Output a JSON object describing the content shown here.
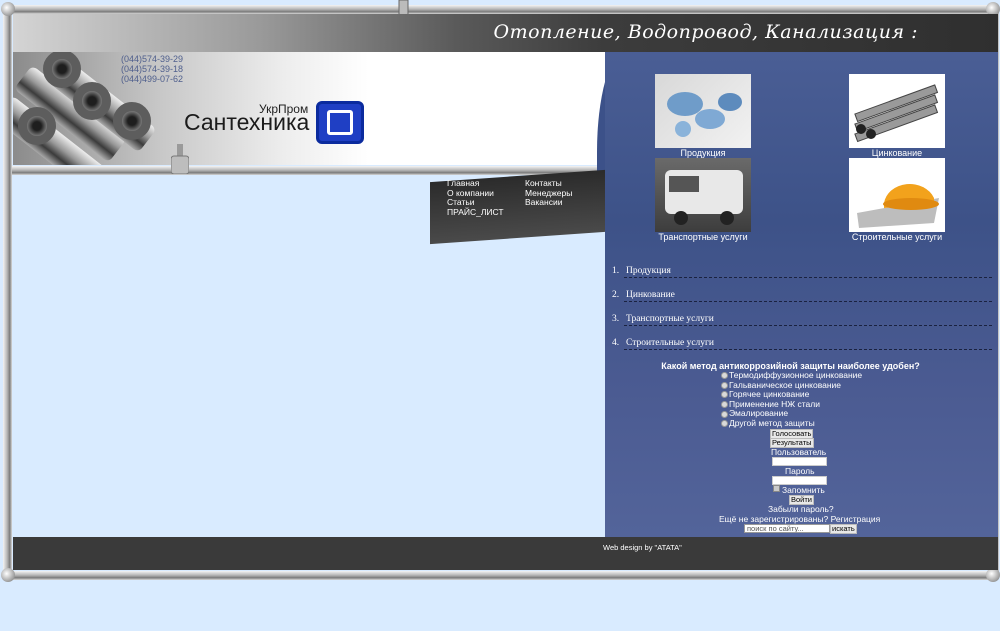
{
  "header": {
    "slogan": "Отопление, Водопровод, Канализация :"
  },
  "banner": {
    "phones": [
      "(044)574-39-29",
      "(044)574-39-18",
      "(044)499-07-62"
    ],
    "brand_small": "УкрПром",
    "brand_big": "Сантехника"
  },
  "menu": {
    "col1": [
      "Главная",
      "О компании",
      "Статьи",
      "ПРАЙС_ЛИСТ"
    ],
    "col2": [
      "Контакты",
      "Менеджеры",
      "Вакансии"
    ]
  },
  "tiles": [
    {
      "label": "Продукция",
      "icon": "pipe-fittings-photo"
    },
    {
      "label": "Цинкование",
      "icon": "steel-pipes-photo"
    },
    {
      "label": "Транспортные услуги",
      "icon": "van-photo"
    },
    {
      "label": "Строительные услуги",
      "icon": "hard-hat-photo"
    }
  ],
  "numbered_list": [
    {
      "num": "1.",
      "text": "Продукция"
    },
    {
      "num": "2.",
      "text": "Цинкование"
    },
    {
      "num": "3.",
      "text": "Транспортные услуги"
    },
    {
      "num": "4.",
      "text": "Строительные услуги"
    }
  ],
  "poll": {
    "question": "Какой метод антикоррозийной защиты наиболее удобен?",
    "options": [
      "Термодиффузионное цинкование",
      "Гальваническое цинкование",
      "Горячее цинкование",
      "Применение НЖ стали",
      "Эмалирование",
      "Другой метод защиты"
    ],
    "vote_label": "Голосовать",
    "results_label": "Результаты"
  },
  "login": {
    "user_label": "Пользователь",
    "password_label": "Пароль",
    "remember_label": "Запомнить",
    "login_button": "Войти",
    "forgot": "Забыли пароль?",
    "register": "Ещё не зарегистрированы? Регистрация"
  },
  "search": {
    "placeholder": "поиск по сайту...",
    "button": "искать"
  },
  "footer": {
    "credit": "Web design by \"ATATA\""
  },
  "colors": {
    "panel": "#40538a",
    "footer": "#3a3a3a",
    "page_bg": "#d9ebff"
  }
}
